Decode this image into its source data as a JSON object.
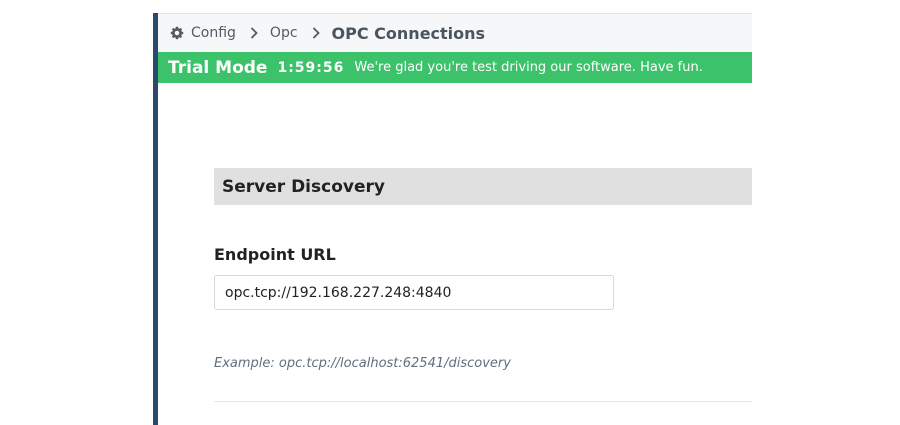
{
  "breadcrumb": {
    "items": [
      {
        "label": "Config",
        "icon": "gear-icon"
      },
      {
        "label": "Opc"
      }
    ],
    "current": "OPC Connections"
  },
  "trial": {
    "title": "Trial Mode",
    "timer": "1:59:56",
    "message": "We're glad you're test driving our software. Have fun."
  },
  "server_discovery": {
    "heading": "Server Discovery",
    "endpoint_label": "Endpoint URL",
    "endpoint_value": "opc.tcp://192.168.227.248:4840",
    "help": "Example: opc.tcp://localhost:62541/discovery"
  },
  "colors": {
    "sidebar_accent": "#2b4a6b",
    "trial_banner": "#3cc26a",
    "section_header_bg": "#e0e0e0"
  }
}
